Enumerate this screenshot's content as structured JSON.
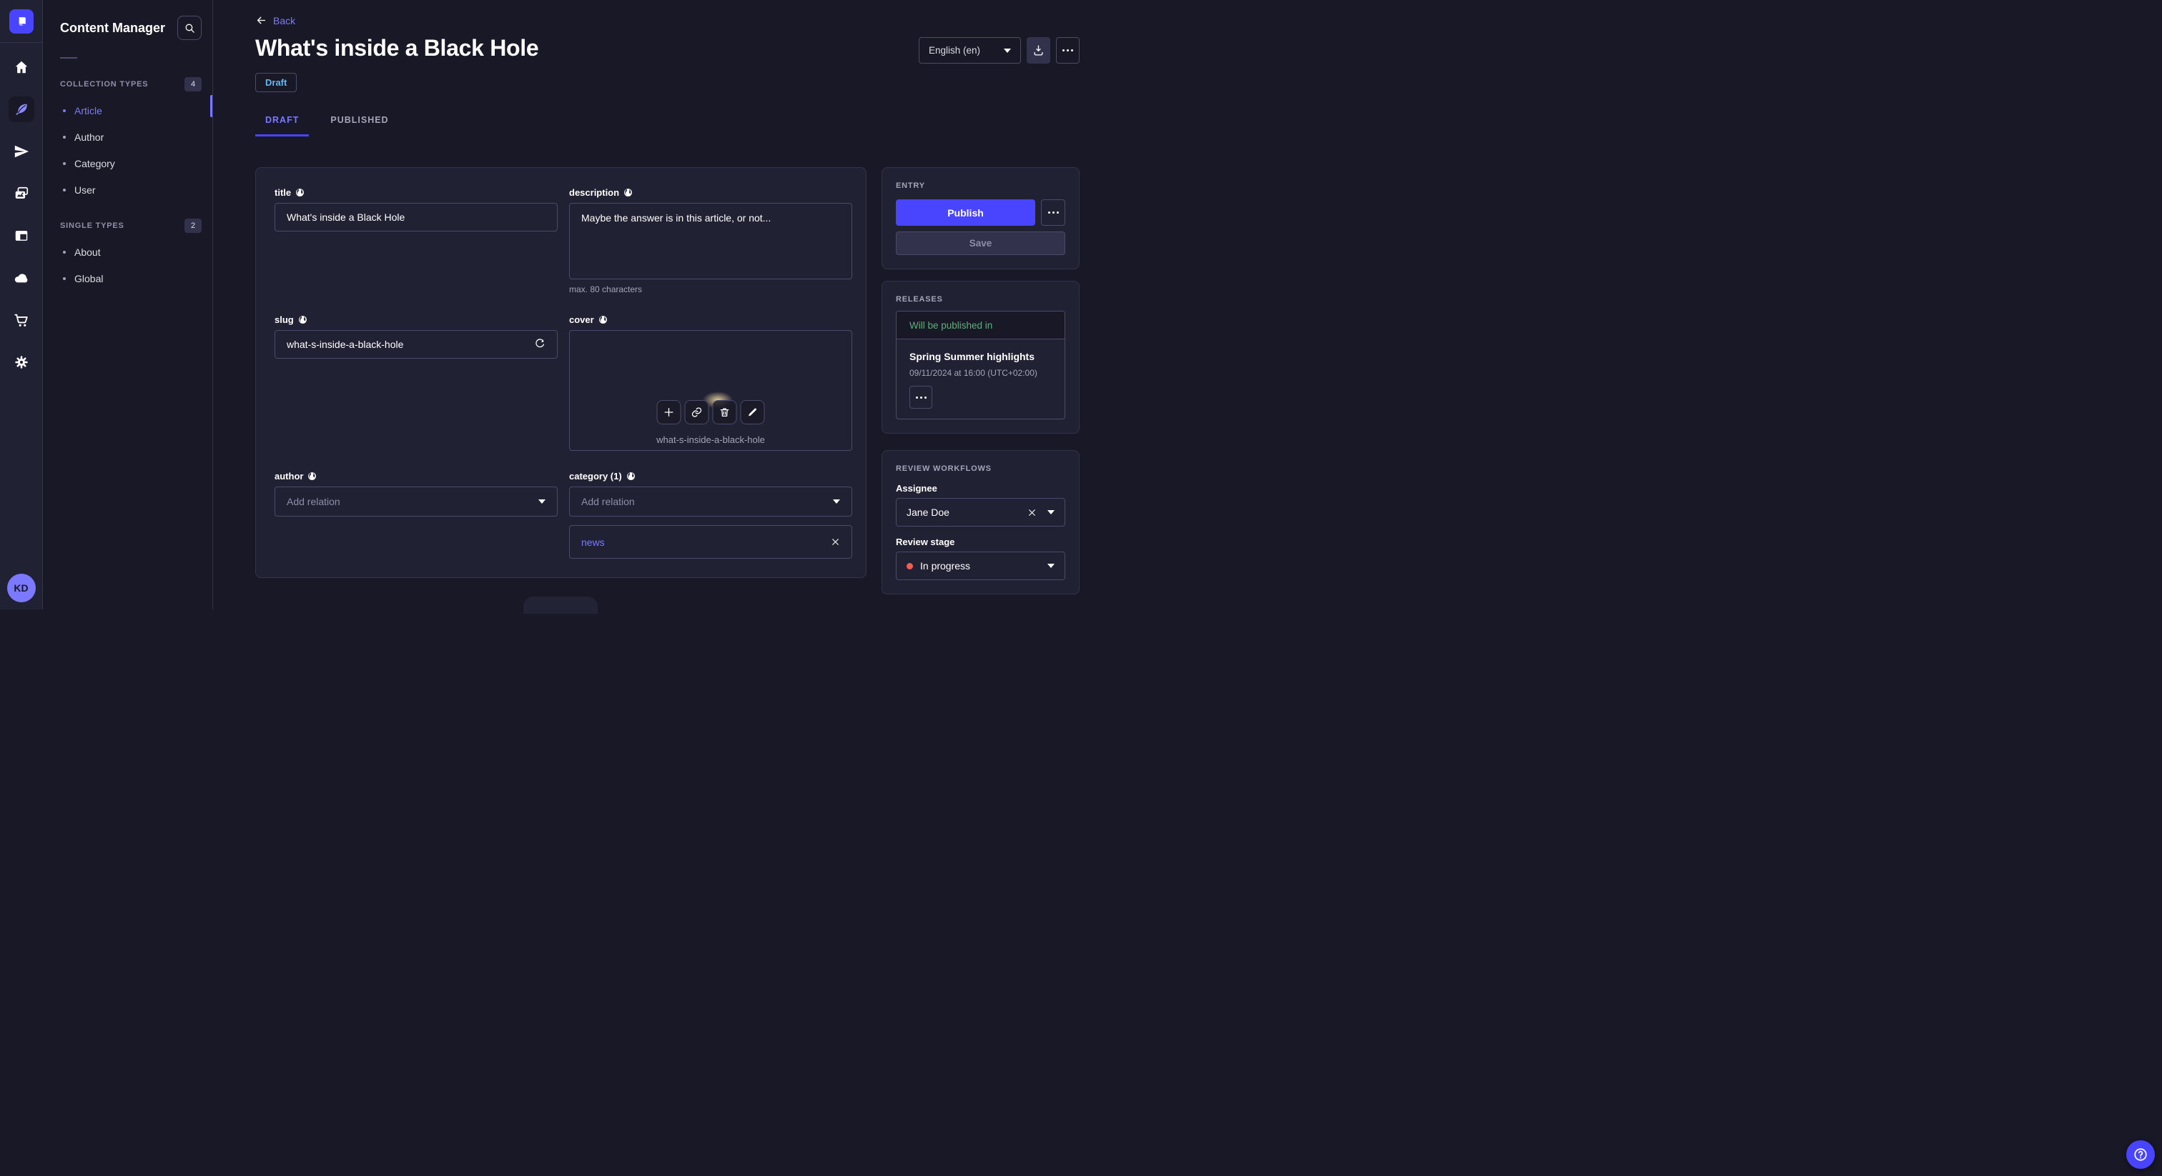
{
  "colors": {
    "primary": "#4945ff",
    "primary_light": "#7b79ff",
    "background": "#181826",
    "card": "#212134",
    "border": "#32324d",
    "input_border": "#4a4a6a",
    "muted_text": "#a5a5ba",
    "draft_blue": "#66b7f1",
    "success_green": "#5cb176",
    "danger_red": "#ee5e52"
  },
  "sidebar": {
    "app_title": "Content Manager",
    "sections": [
      {
        "label": "COLLECTION TYPES",
        "count": "4",
        "items": [
          {
            "label": "Article",
            "active": true
          },
          {
            "label": "Author"
          },
          {
            "label": "Category"
          },
          {
            "label": "User"
          }
        ]
      },
      {
        "label": "SINGLE TYPES",
        "count": "2",
        "items": [
          {
            "label": "About"
          },
          {
            "label": "Global"
          }
        ]
      }
    ]
  },
  "rail": {
    "avatar_initials": "KD"
  },
  "header": {
    "back_label": "Back",
    "title": "What's inside a Black Hole",
    "status_badge": "Draft",
    "locale_value": "English (en)"
  },
  "tabs": [
    {
      "label": "DRAFT",
      "active": true
    },
    {
      "label": "PUBLISHED",
      "active": false
    }
  ],
  "form": {
    "title": {
      "label": "title",
      "value": "What's inside a Black Hole"
    },
    "description": {
      "label": "description",
      "value": "Maybe the answer is in this article, or not...",
      "hint": "max. 80 characters"
    },
    "slug": {
      "label": "slug",
      "value": "what-s-inside-a-black-hole"
    },
    "cover": {
      "label": "cover",
      "caption": "what-s-inside-a-black-hole"
    },
    "author": {
      "label": "author",
      "placeholder": "Add relation"
    },
    "category": {
      "label": "category (1)",
      "placeholder": "Add relation",
      "relations": [
        {
          "label": "news"
        }
      ]
    }
  },
  "entry_panel": {
    "title": "ENTRY",
    "publish_label": "Publish",
    "save_label": "Save"
  },
  "releases_panel": {
    "title": "RELEASES",
    "card_header": "Will be published in",
    "release_name": "Spring Summer highlights",
    "release_date": "09/11/2024 at 16:00 (UTC+02:00)"
  },
  "review_panel": {
    "title": "REVIEW WORKFLOWS",
    "assignee_label": "Assignee",
    "assignee_value": "Jane Doe",
    "stage_label": "Review stage",
    "stage_value": "In progress"
  }
}
